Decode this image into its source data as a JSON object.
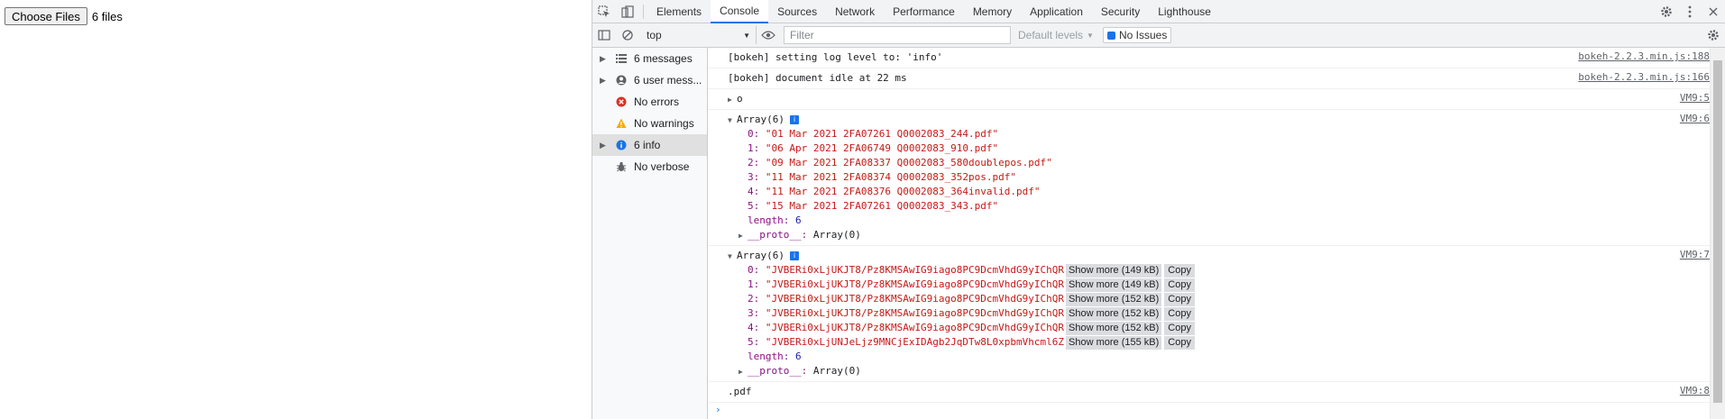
{
  "page": {
    "choose_files_label": "Choose Files",
    "files_text": "6 files"
  },
  "devtools": {
    "tabs": [
      {
        "label": "Elements"
      },
      {
        "label": "Console"
      },
      {
        "label": "Sources"
      },
      {
        "label": "Network"
      },
      {
        "label": "Performance"
      },
      {
        "label": "Memory"
      },
      {
        "label": "Application"
      },
      {
        "label": "Security"
      },
      {
        "label": "Lighthouse"
      }
    ],
    "active_tab": "Console",
    "toolbar": {
      "context": "top",
      "filter_placeholder": "Filter",
      "levels": "Default levels",
      "issues": "No Issues"
    },
    "sidebar": [
      {
        "label": "6 messages",
        "icon": "list-icon"
      },
      {
        "label": "6 user mess...",
        "icon": "user-icon"
      },
      {
        "label": "No errors",
        "icon": "error-icon"
      },
      {
        "label": "No warnings",
        "icon": "warning-icon"
      },
      {
        "label": "6 info",
        "icon": "info-icon"
      },
      {
        "label": "No verbose",
        "icon": "bug-icon"
      }
    ],
    "console": {
      "log1": {
        "text": "[bokeh] setting log level to: 'info'",
        "src": "bokeh-2.2.3.min.js:188"
      },
      "log2": {
        "text": "[bokeh] document idle at 22 ms",
        "src": "bokeh-2.2.3.min.js:166"
      },
      "log3": {
        "text": "o",
        "src": "VM9:5"
      },
      "arr1": {
        "header": "Array(6)",
        "src": "VM9:6",
        "items": [
          {
            "k": "0:",
            "v": "\"01 Mar 2021 2FA07261 Q0002083_244.pdf\""
          },
          {
            "k": "1:",
            "v": "\"06 Apr 2021 2FA06749 Q0002083_910.pdf\""
          },
          {
            "k": "2:",
            "v": "\"09 Mar 2021 2FA08337 Q0002083_580doublepos.pdf\""
          },
          {
            "k": "3:",
            "v": "\"11 Mar 2021 2FA08374 Q0002083_352pos.pdf\""
          },
          {
            "k": "4:",
            "v": "\"11 Mar 2021 2FA08376 Q0002083_364invalid.pdf\""
          },
          {
            "k": "5:",
            "v": "\"15 Mar 2021 2FA07261 Q0002083_343.pdf\""
          }
        ],
        "length_key": "length:",
        "length_val": "6",
        "proto_key": "__proto__:",
        "proto_val": "Array(0)"
      },
      "arr2": {
        "header": "Array(6)",
        "src": "VM9:7",
        "items": [
          {
            "k": "0:",
            "v": "\"JVBERi0xLjUKJT8/Pz8KMSAwIG9iago8PC9DcmVhdG9yIChQR",
            "more": "Show more (149 kB)",
            "copy": "Copy"
          },
          {
            "k": "1:",
            "v": "\"JVBERi0xLjUKJT8/Pz8KMSAwIG9iago8PC9DcmVhdG9yIChQR",
            "more": "Show more (149 kB)",
            "copy": "Copy"
          },
          {
            "k": "2:",
            "v": "\"JVBERi0xLjUKJT8/Pz8KMSAwIG9iago8PC9DcmVhdG9yIChQR",
            "more": "Show more (152 kB)",
            "copy": "Copy"
          },
          {
            "k": "3:",
            "v": "\"JVBERi0xLjUKJT8/Pz8KMSAwIG9iago8PC9DcmVhdG9yIChQR",
            "more": "Show more (152 kB)",
            "copy": "Copy"
          },
          {
            "k": "4:",
            "v": "\"JVBERi0xLjUKJT8/Pz8KMSAwIG9iago8PC9DcmVhdG9yIChQR",
            "more": "Show more (152 kB)",
            "copy": "Copy"
          },
          {
            "k": "5:",
            "v": "\"JVBERi0xLjUNJeLjz9MNCjExIDAgb2JqDTw8L0xpbmVhcml6Z",
            "more": "Show more (155 kB)",
            "copy": "Copy"
          }
        ],
        "length_key": "length:",
        "length_val": "6",
        "proto_key": "__proto__:",
        "proto_val": "Array(0)"
      },
      "log4": {
        "text": ".pdf",
        "src": "VM9:8"
      },
      "prompt": "›"
    }
  }
}
